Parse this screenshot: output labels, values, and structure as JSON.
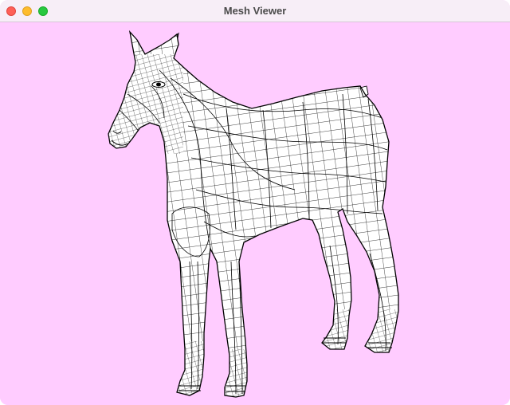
{
  "window": {
    "title": "Mesh Viewer",
    "controls": {
      "close": "close",
      "minimize": "minimize",
      "zoom": "zoom"
    }
  },
  "viewport": {
    "background_color": "#ffccff",
    "model": {
      "subject": "horse",
      "render_style": "wireframe",
      "fill_color": "#ffffff",
      "line_color": "#000000"
    }
  }
}
